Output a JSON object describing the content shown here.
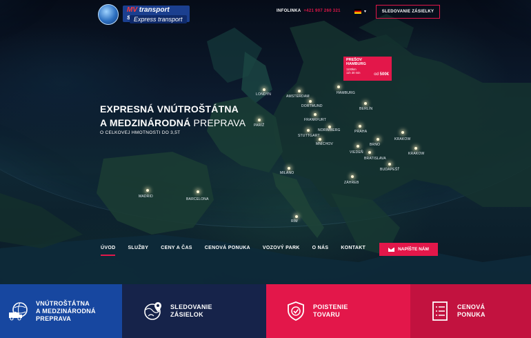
{
  "header": {
    "logo_title_a": "MV",
    "logo_title_b": " transport s.r.o.",
    "logo_subtitle": "Express transport",
    "infolinka_label": "INFOLINKA",
    "infolinka_number": "+421 907 260 321",
    "language_flag": "flag-de-icon",
    "track_button": "SLEDOVANIE ZÁSIELKY"
  },
  "promo": {
    "route_from": "PREŠOV",
    "route_to": "HAMBURG",
    "distance": "1100km",
    "duration": "11h 30 min",
    "price_prefix": "od",
    "price": "500€"
  },
  "hero": {
    "headline_line1": "EXPRESNÁ VNÚTROŠTÁTNA",
    "headline_line2_bold": "A MEDZINÁRODNÁ ",
    "headline_line2_light": "PREPRAVA",
    "subheadline": "O CELKOVEJ HMOTNOSTI DO 3,5T"
  },
  "map": {
    "cities": [
      {
        "name": "LONDÝN"
      },
      {
        "name": "AMSTERDAM"
      },
      {
        "name": "HAMBURG"
      },
      {
        "name": "DORTMUND"
      },
      {
        "name": "BERLÍN"
      },
      {
        "name": "FRANKFURT"
      },
      {
        "name": "PARÍŽ"
      },
      {
        "name": "NORIMBERG"
      },
      {
        "name": "PRAHA"
      },
      {
        "name": "STUTTGART"
      },
      {
        "name": "MNÍCHOV"
      },
      {
        "name": "KRAKOW"
      },
      {
        "name": "BRNO"
      },
      {
        "name": "KRAKOW"
      },
      {
        "name": "VIEDEŇ"
      },
      {
        "name": "BRATISLAVA"
      },
      {
        "name": "BUDAPEŠŤ"
      },
      {
        "name": "MILÁNO"
      },
      {
        "name": "ZÁHREB"
      },
      {
        "name": "MADRID"
      },
      {
        "name": "BARCELONA"
      },
      {
        "name": "RÍM"
      }
    ]
  },
  "nav": {
    "items": [
      {
        "label": "ÚVOD",
        "active": true
      },
      {
        "label": "SLUŽBY",
        "active": false
      },
      {
        "label": "CENY A ČAS",
        "active": false
      },
      {
        "label": "CENOVÁ PONUKA",
        "active": false
      },
      {
        "label": "VOZOVÝ PARK",
        "active": false
      },
      {
        "label": "O NÁS",
        "active": false
      },
      {
        "label": "KONTAKT",
        "active": false
      }
    ],
    "write_button": "NAPÍŠTE NÁM"
  },
  "tiles": [
    {
      "label": "VNÚTROŠTÁTNA\nA MEDZINÁRODNÁ\nPREPRAVA",
      "icon": "delivery-globe-icon",
      "color": "#1747a0"
    },
    {
      "label": "SLEDOVANIE\nZÁSIELOK",
      "icon": "globe-pin-icon",
      "color": "#16234a"
    },
    {
      "label": "POISTENIE\nTOVARU",
      "icon": "shield-check-icon",
      "color": "#e3174a"
    },
    {
      "label": "CENOVÁ\nPONUKA",
      "icon": "document-list-icon",
      "color": "#c2123f"
    }
  ],
  "colors": {
    "accent": "#e3174a",
    "dark_navy": "#16234a",
    "blue": "#1747a0"
  }
}
